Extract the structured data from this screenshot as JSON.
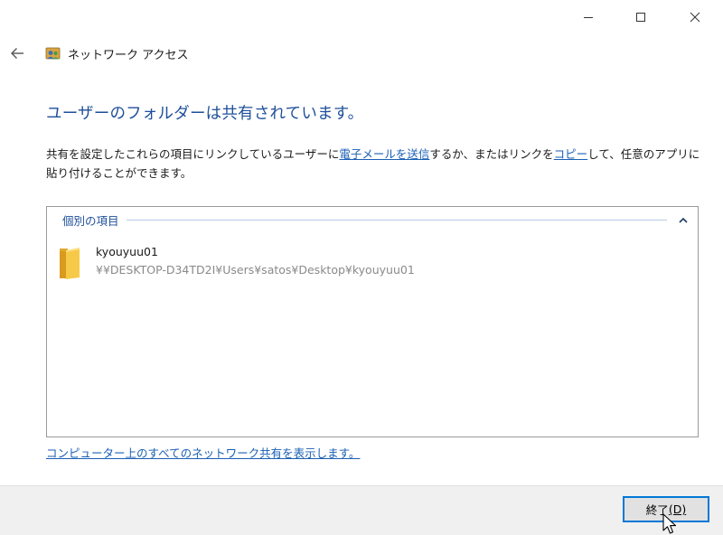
{
  "window": {
    "controls": {
      "minimize_icon": "minimize-icon",
      "maximize_icon": "maximize-icon",
      "close_icon": "close-icon"
    }
  },
  "header": {
    "back_icon": "back-arrow-icon",
    "app_icon": "network-access-icon",
    "title": "ネットワーク アクセス"
  },
  "main": {
    "heading": "ユーザーのフォルダーは共有されています。",
    "description": {
      "part1": "共有を設定したこれらの項目にリンクしているユーザーに",
      "email_link": "電子メールを送信",
      "part2": "するか、またはリンクを",
      "copy_link": "コピー",
      "part3": "して、任意のアプリに貼り付けることができます。"
    },
    "items_group": {
      "label": "個別の項目",
      "toggle_icon": "chevron-up-icon",
      "items": [
        {
          "icon": "folder-icon",
          "name": "kyouyuu01",
          "path": "¥¥DESKTOP-D34TD2I¥Users¥satos¥Desktop¥kyouyuu01"
        }
      ]
    },
    "all_shares_link": "コンピューター上のすべてのネットワーク共有を表示します。"
  },
  "footer": {
    "finish_label": "終了",
    "finish_accesskey": "(D)"
  },
  "colors": {
    "heading": "#1e4f9a",
    "link": "#1a5fb4",
    "button_focus": "#0078d7",
    "footer_bg": "#f0f0f0"
  }
}
